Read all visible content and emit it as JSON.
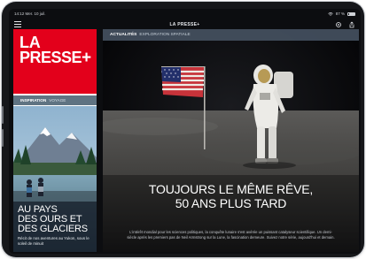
{
  "statusbar": {
    "time": "14:12",
    "date": "Mer. 10 juil.",
    "battery": "87 %"
  },
  "appbar": {
    "title": "LA PRESSE+"
  },
  "logo": {
    "line1": "LA",
    "line2": "PRESSE",
    "plus": "+"
  },
  "left_card": {
    "section": "INSPIRATION",
    "subsection": "VOYAGE",
    "title_line1": "AU PAYS",
    "title_line2": "DES OURS ET",
    "title_line3": "DES GLACIERS",
    "subtitle": "Récit de nos aventures au Yukon, sous le soleil de minuit"
  },
  "main": {
    "section": "ACTUALITÉS",
    "subsection": "EXPLORATION SPATIALE",
    "title_line1": "TOUJOURS LE MÊME RÊVE,",
    "title_line2": "50 ANS PLUS TARD",
    "subtitle": "L'intérêt mondial pour les sciences politiques, la conquête lunaire s'est avérée un puissant catalyseur scientifique. Un demi-siècle après les premiers pas de Neil Armstrong sur la Lune, la fascination demeure. Suivez notre série, aujourd'hui et demain."
  },
  "colors": {
    "brand_red": "#e3001b",
    "tag_bar": "#445060",
    "inspiration_bar": "#5f7382"
  },
  "icons": [
    "menu-icon",
    "settings-icon",
    "share-icon",
    "wifi-icon",
    "battery-icon"
  ]
}
